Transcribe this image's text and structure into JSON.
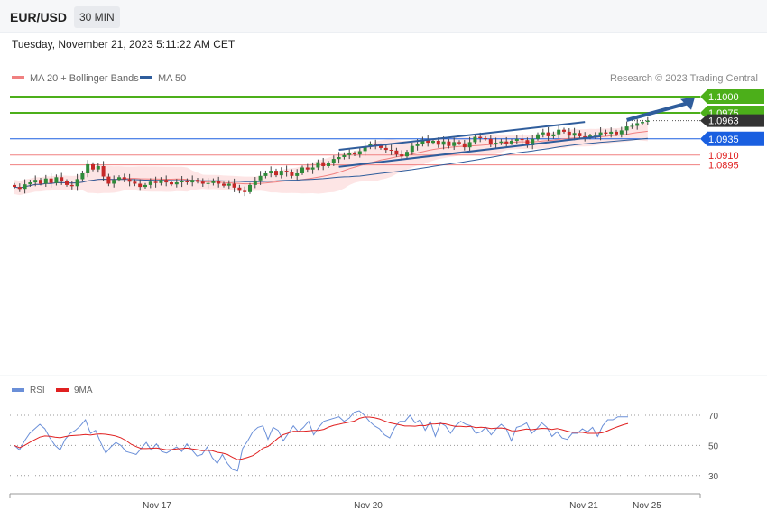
{
  "header": {
    "symbol": "EUR/USD",
    "timeframe": "30 MIN",
    "datetime": "Tuesday, November 21, 2023 5:11:22 AM CET",
    "credit": "Research © 2023 Trading Central"
  },
  "colors": {
    "candle_up": "#2e8b3a",
    "candle_down": "#c62828",
    "ma20": "#f08080",
    "band_fill": "#fde0e0",
    "ma50": "#2f5d9c",
    "target_green": "#4caf1a",
    "pivot_blue": "#1a5fe0",
    "support_red": "#f08080",
    "current_price_bg": "#333333",
    "rsi_line": "#6a8fd8",
    "rsi_ma": "#e02020"
  },
  "chart_data": [
    {
      "type": "candlestick",
      "legend": [
        {
          "name": "MA 20 + Bollinger Bands",
          "color": "#f08080"
        },
        {
          "name": "MA 50",
          "color": "#2f5d9c"
        }
      ],
      "x_labels": [
        "Nov 17",
        "Nov 20",
        "Nov 21",
        "Nov 25"
      ],
      "ylim": [
        1.08,
        1.1015
      ],
      "levels": [
        {
          "value": 1.1,
          "label": "1.1000",
          "kind": "resistance"
        },
        {
          "value": 1.0975,
          "label": "1.0975",
          "kind": "resistance"
        },
        {
          "value": 1.0963,
          "label": "1.0963",
          "kind": "current"
        },
        {
          "value": 1.0935,
          "label": "1.0935",
          "kind": "pivot"
        },
        {
          "value": 1.091,
          "label": "1.0910",
          "kind": "support"
        },
        {
          "value": 1.0895,
          "label": "1.0895",
          "kind": "support"
        }
      ],
      "channel": {
        "upper": [
          [
            62,
            1.0918
          ],
          [
            109,
            1.0961
          ]
        ],
        "lower": [
          [
            62,
            1.0892
          ],
          [
            112,
            1.0939
          ]
        ]
      },
      "arrow": {
        "from": [
          117,
          1.0964
        ],
        "to": [
          130,
          1.0999
        ]
      },
      "close": [
        1.0861,
        1.0858,
        1.0865,
        1.0868,
        1.0872,
        1.0866,
        1.0874,
        1.0867,
        1.0876,
        1.087,
        1.0864,
        1.0862,
        1.0873,
        1.0882,
        1.0896,
        1.0888,
        1.0893,
        1.0877,
        1.0866,
        1.0872,
        1.0876,
        1.0873,
        1.0869,
        1.0866,
        1.0861,
        1.0864,
        1.0869,
        1.0867,
        1.0872,
        1.0868,
        1.0865,
        1.0868,
        1.087,
        1.0868,
        1.0872,
        1.0869,
        1.0866,
        1.0867,
        1.087,
        1.0866,
        1.0863,
        1.0866,
        1.086,
        1.0855,
        1.0853,
        1.0864,
        1.0871,
        1.0878,
        1.0882,
        1.0886,
        1.0879,
        1.0886,
        1.0884,
        1.0878,
        1.0882,
        1.0891,
        1.0888,
        1.0891,
        1.0899,
        1.0893,
        1.0898,
        1.0904,
        1.0907,
        1.091,
        1.0913,
        1.0911,
        1.0916,
        1.0923,
        1.0927,
        1.0925,
        1.0921,
        1.0918,
        1.0917,
        1.0911,
        1.0908,
        1.0915,
        1.0924,
        1.0927,
        1.0934,
        1.0929,
        1.0932,
        1.0926,
        1.0931,
        1.0924,
        1.093,
        1.0928,
        1.0922,
        1.093,
        1.0938,
        1.0936,
        1.0935,
        1.0927,
        1.0929,
        1.0931,
        1.0928,
        1.0932,
        1.0935,
        1.0933,
        1.0925,
        1.0935,
        1.0942,
        1.0945,
        1.0939,
        1.0942,
        1.0949,
        1.0946,
        1.094,
        1.0944,
        1.0939,
        1.0937,
        1.094,
        1.094,
        1.0945,
        1.0943,
        1.0946,
        1.0942,
        1.0948,
        1.0954,
        1.0955,
        1.0959,
        1.0961,
        1.0963
      ],
      "rsi": {
        "series": [
          {
            "name": "RSI"
          },
          {
            "name": "9MA"
          }
        ],
        "y_ticks": [
          70,
          50,
          30
        ],
        "ylim": [
          25,
          75
        ],
        "values": [
          50,
          47,
          53,
          58,
          61,
          64,
          61,
          55,
          50,
          47,
          54,
          58,
          60,
          63,
          67,
          58,
          60,
          52,
          45,
          49,
          52,
          50,
          46,
          45,
          44,
          48,
          52,
          47,
          51,
          46,
          45,
          47,
          49,
          46,
          51,
          47,
          43,
          44,
          49,
          42,
          38,
          44,
          38,
          34,
          33,
          48,
          53,
          59,
          62,
          63,
          54,
          62,
          60,
          53,
          58,
          63,
          59,
          62,
          66,
          57,
          62,
          66,
          67,
          68,
          69,
          66,
          68,
          72,
          73,
          70,
          66,
          63,
          61,
          57,
          55,
          62,
          66,
          66,
          70,
          65,
          67,
          60,
          66,
          56,
          65,
          63,
          58,
          63,
          66,
          64,
          63,
          58,
          59,
          62,
          57,
          61,
          64,
          61,
          53,
          62,
          63,
          65,
          58,
          61,
          65,
          62,
          56,
          59,
          55,
          54,
          58,
          58,
          61,
          59,
          62,
          56,
          63,
          67,
          67,
          69,
          69,
          69
        ]
      }
    }
  ]
}
